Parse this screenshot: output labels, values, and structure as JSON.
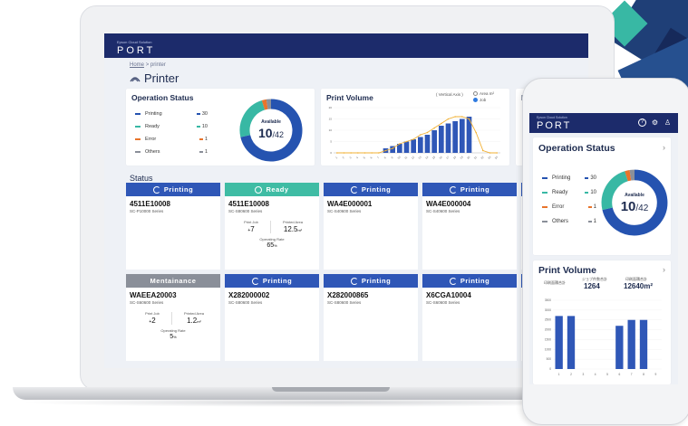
{
  "laptop": {
    "brand_sub": "Epson Cloud Solution",
    "brand": "PORT",
    "breadcrumb": {
      "home": "Home",
      "separator": ">",
      "current": "printer"
    },
    "page_title": "Printer",
    "operation_status": {
      "title": "Operation Status",
      "legend": [
        {
          "label": "Printing",
          "count": "30",
          "color": "#2553b0"
        },
        {
          "label": "Ready",
          "count": "10",
          "color": "#38b8a4"
        },
        {
          "label": "Error",
          "count": "1",
          "color": "#e8742b"
        },
        {
          "label": "Others",
          "count": "1",
          "color": "#8a8f99"
        }
      ],
      "donut_label": "Available",
      "donut_value": "10",
      "donut_total": "/42"
    },
    "print_volume": {
      "title": "Print Volume",
      "mode": "( Vertical Axis )",
      "opt_area": "Area m²",
      "opt_job": "Job"
    },
    "third_card_title": "Re",
    "status_title": "Status",
    "cards": [
      {
        "state": "Printing",
        "serial": "4511E10008",
        "model": "SC-P10000 Series",
        "color": "#2f57b7"
      },
      {
        "state": "Ready",
        "serial": "4511E10008",
        "model": "SC-S80600 Series",
        "color": "#3fbca4",
        "print_job_label": "Print Job",
        "print_job": "7",
        "printed_area_label": "Printed Area",
        "printed_area": "12.5",
        "printed_area_unit": "m²",
        "op_rate_label": "Operating Rate",
        "op_rate": "65",
        "op_rate_unit": "%"
      },
      {
        "state": "Printing",
        "serial": "WA4E000001",
        "model": "SC-S40600 Series",
        "color": "#2f57b7"
      },
      {
        "state": "Printing",
        "serial": "WA4E000004",
        "model": "SC-S40600 Series",
        "color": "#2f57b7"
      },
      {
        "state": "Mentainance",
        "serial": "WAEEA20003",
        "model": "SC-S60600 Series",
        "color": "#8a8f99",
        "print_job_label": "Print Job",
        "print_job": "2",
        "printed_area_label": "Printed Area",
        "printed_area": "1.2",
        "printed_area_unit": "m²",
        "op_rate_label": "Operating Rate",
        "op_rate": "5",
        "op_rate_unit": "%"
      },
      {
        "state": "Printing",
        "serial": "X282000002",
        "model": "SC-S80600 Series",
        "color": "#2f57b7"
      },
      {
        "state": "Printing",
        "serial": "X282000865",
        "model": "SC-S80600 Series",
        "color": "#2f57b7"
      },
      {
        "state": "Printing",
        "serial": "X6CGA10004",
        "model": "SC-S60600 Series",
        "color": "#2f57b7"
      }
    ]
  },
  "phone": {
    "brand_sub": "Epson Cloud Solution",
    "brand": "PORT",
    "operation_status": {
      "title": "Operation Status",
      "legend": [
        {
          "label": "Printing",
          "count": "30",
          "color": "#2553b0"
        },
        {
          "label": "Ready",
          "count": "10",
          "color": "#38b8a4"
        },
        {
          "label": "Error",
          "count": "1",
          "color": "#e8742b"
        },
        {
          "label": "Others",
          "count": "1",
          "color": "#8a8f99"
        }
      ],
      "donut_label": "Available",
      "donut_value": "10",
      "donut_total": "/42"
    },
    "print_volume": {
      "title": "Print Volume",
      "stat1_label": "印刷面積合計",
      "stat1_value": "",
      "stat2_label": "ジョブ件数合計",
      "stat2_value": "1264",
      "stat3_label": "印刷面積合計",
      "stat3_value": "12640m²"
    }
  },
  "chart_data": [
    {
      "type": "bar",
      "title": "Print Volume",
      "categories": [
        "1",
        "2",
        "3",
        "4",
        "5",
        "6",
        "7",
        "8",
        "9",
        "10",
        "11",
        "12",
        "13",
        "14",
        "15",
        "16",
        "17",
        "18",
        "19",
        "20",
        "21",
        "22",
        "23",
        "24"
      ],
      "series": [
        {
          "name": "Job",
          "values": [
            0,
            0,
            0,
            0,
            0,
            0,
            0,
            2,
            3,
            4,
            5,
            6,
            7,
            8,
            10,
            12,
            13,
            14,
            15,
            16,
            0,
            0,
            0,
            0
          ]
        },
        {
          "name": "Area m²",
          "values": [
            0,
            0,
            0,
            0,
            0,
            0,
            0,
            1,
            2,
            4,
            5,
            6,
            8,
            9,
            11,
            13,
            15,
            16,
            16,
            15,
            9,
            1,
            0,
            0
          ]
        }
      ],
      "ylim": [
        0,
        20
      ]
    },
    {
      "type": "bar",
      "title": "Print Volume",
      "categories": [
        "1",
        "2",
        "3",
        "4",
        "5",
        "6",
        "7",
        "8",
        "9"
      ],
      "values": [
        2700,
        2700,
        0,
        0,
        0,
        2200,
        2500,
        2500,
        0
      ],
      "ylim": [
        0,
        3500
      ]
    }
  ]
}
